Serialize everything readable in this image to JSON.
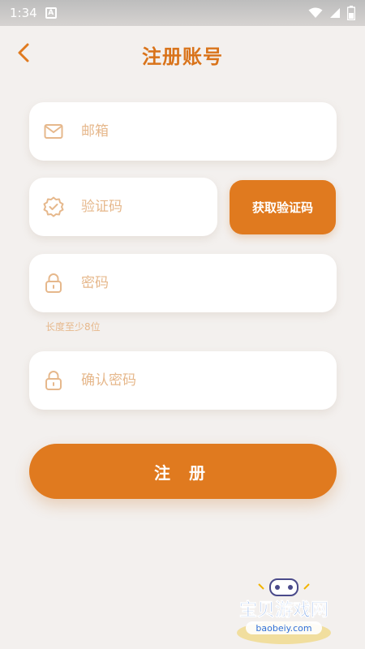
{
  "status_bar": {
    "time": "1:34",
    "notif_letter": "A"
  },
  "header": {
    "title": "注册账号"
  },
  "form": {
    "email_placeholder": "邮箱",
    "code_placeholder": "验证码",
    "get_code_label": "获取验证码",
    "password_placeholder": "密码",
    "password_hint": "长度至少8位",
    "confirm_placeholder": "确认密码",
    "register_label": "注 册"
  },
  "watermark": {
    "text": "宝贝游戏网",
    "url": "baobeiy.com"
  },
  "colors": {
    "accent": "#e07a1f",
    "title": "#d9731a",
    "placeholder": "#e6b88c",
    "background": "#f3f0ee",
    "field": "#ffffff"
  },
  "icons": {
    "email": "mail-icon",
    "code": "badge-check-icon",
    "password": "lock-icon",
    "confirm": "lock-icon",
    "back": "chevron-left-icon"
  }
}
